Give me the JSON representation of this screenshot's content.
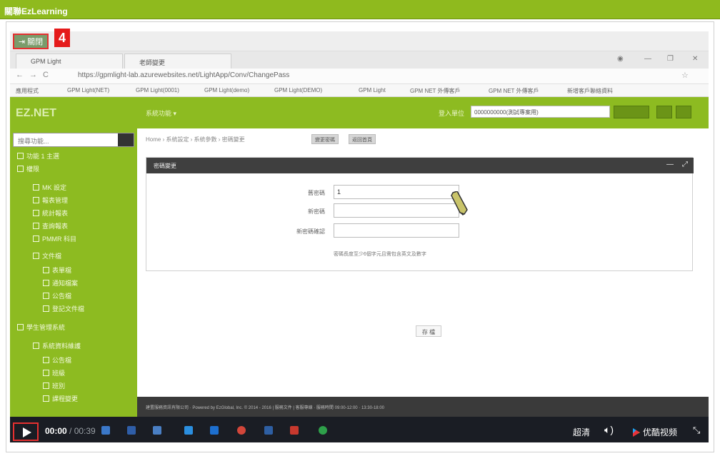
{
  "window": {
    "title": "關聯EzLearning"
  },
  "toolbar": {
    "close_label": "關閉",
    "step_badge": "4"
  },
  "browser": {
    "tabs": [
      "GPM Light",
      "老師變更"
    ],
    "url": "https://gpmlight-lab.azurewebsites.net/LightApp/Conv/ChangePass",
    "bookmarks": [
      "應用程式",
      "GPM Light(NET)",
      "GPM Light(0001)",
      "GPM Light(demo)",
      "GPM Light(DEMO)",
      "GPM Light",
      "GPM NET 外傳客戶",
      "GPM NET 外傳客戶",
      "新增客戶聯絡資料"
    ]
  },
  "app": {
    "logo": "EZ.NET",
    "menu": "系統功能 ▾",
    "login_label": "登入單位",
    "login_value": "0000000000(測試專案用)",
    "search_placeholder": "搜尋功能...",
    "sidebar": [
      "功能 1 主選",
      "權限",
      "MK 設定",
      "報表管理",
      "統計報表",
      "查詢報表",
      "PMMR 科目",
      "文件檔",
      "表單檔",
      "通知檔案",
      "公告檔",
      "登記文件檔",
      "學生管理系統",
      "系統資料維護",
      "公告檔",
      "班級",
      "班別",
      "課程變更"
    ],
    "breadcrumb": "Home › 系統設定 › 系統參數 › 密碼變更",
    "tag1": "變更密碼",
    "tag2": "返回首頁",
    "panel_title": "密碼變更",
    "fields": [
      "舊密碼",
      "新密碼",
      "新密碼確認"
    ],
    "old_password_value": "1",
    "hint": "密碼長度至少6個字元且需包含英文及數字",
    "save_label": "存 檔",
    "footer": "建置服務資訊有限公司 · Powered by EzGlobal, Inc. © 2014 - 2016 | 服務文件 | 客服專線 · 服務時間 09:00-12:00 · 13:30-18:00"
  },
  "player": {
    "current_time": "00:00",
    "total_time": " / 00:39",
    "quality": "超清",
    "volume_icon": "speaker-icon",
    "brand": "优酷视频",
    "fullscreen_icon": "fullscreen-icon"
  }
}
